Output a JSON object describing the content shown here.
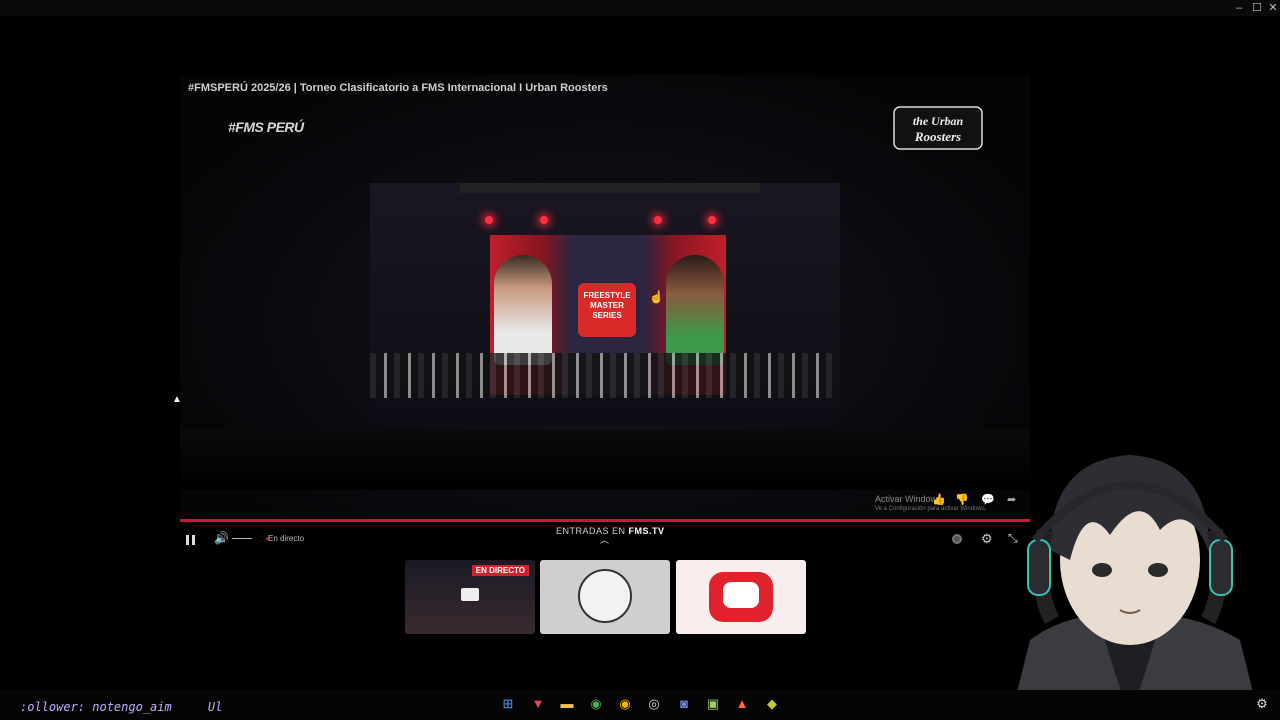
{
  "window": {
    "controls": [
      "–",
      "☐",
      "✕"
    ]
  },
  "video": {
    "title": "#FMSPERÚ 2025/26 | Torneo Clasificatorio a FMS Internacional I Urban Roosters",
    "logo_left": "#FMS PERÚ",
    "logo_right": "the Urban Roosters",
    "screen_badge": "FREESTYLE MASTER SERIES",
    "watermark_title": "Activar Windows",
    "watermark_sub": "Ve a Configuración para activar Windows."
  },
  "player": {
    "live_label": "En directo",
    "banner_prefix": "ENTRADAS EN ",
    "banner_site": "FMS.TV",
    "progress": 1.0
  },
  "thumbnails": [
    {
      "name": "live-stream",
      "badge": "EN DIRECTO"
    },
    {
      "name": "channel-avatar",
      "badge": ""
    },
    {
      "name": "discord",
      "badge": ""
    }
  ],
  "ticker": ":ollower: notengo_aim     Ul",
  "colors": {
    "accent": "#c41a3a",
    "ticker": "#c7a7ff"
  },
  "taskbar_icons": [
    "windows-start-icon",
    "app-icon",
    "file-explorer-icon",
    "chrome-icon",
    "chrome-beta-icon",
    "obs-icon",
    "discord-icon",
    "paint-icon",
    "brave-icon",
    "game-icon"
  ]
}
